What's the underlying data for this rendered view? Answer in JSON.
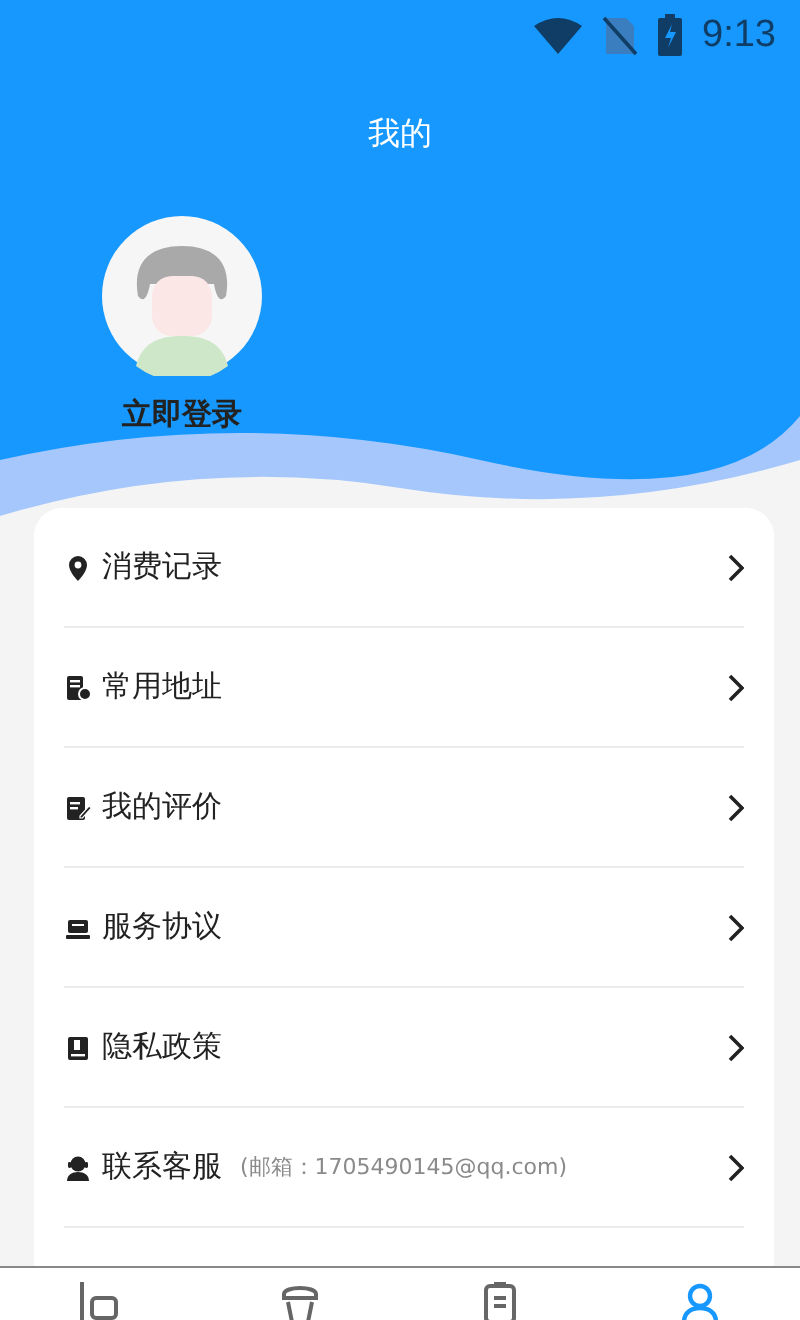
{
  "status_bar": {
    "time": "9:13"
  },
  "header": {
    "title": "我的"
  },
  "profile": {
    "login_label": "立即登录"
  },
  "menu": [
    {
      "label": "消费记录"
    },
    {
      "label": "常用地址"
    },
    {
      "label": "我的评价"
    },
    {
      "label": "服务协议"
    },
    {
      "label": "隐私政策"
    },
    {
      "label": "联系客服",
      "note": "(邮箱：1705490145@qq.com)"
    }
  ],
  "tab_bar": [
    {
      "selected": false
    },
    {
      "selected": false
    },
    {
      "selected": false
    },
    {
      "selected": true
    }
  ]
}
